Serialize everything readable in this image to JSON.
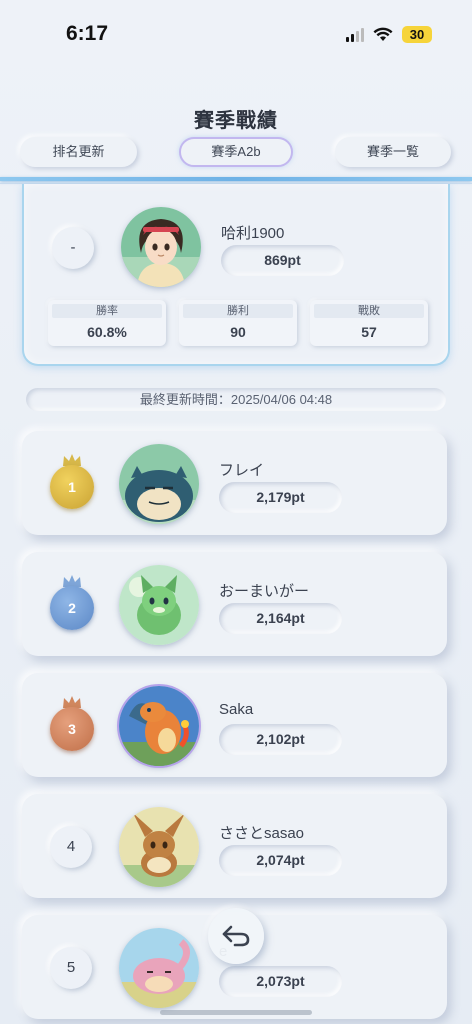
{
  "status_bar": {
    "time": "6:17",
    "battery": "30"
  },
  "header": {
    "title": "賽季戰績",
    "tabs": [
      {
        "label": "排名更新"
      },
      {
        "label": "賽季A2b"
      },
      {
        "label": "賽季一覧"
      }
    ]
  },
  "my_record": {
    "rank": "-",
    "name": "哈利1900",
    "points": "869pt",
    "stats": [
      {
        "label": "勝率",
        "value": "60.8%"
      },
      {
        "label": "勝利",
        "value": "90"
      },
      {
        "label": "戰敗",
        "value": "57"
      }
    ]
  },
  "last_updated": "最終更新時間：2025/04/06 04:48",
  "ranking": [
    {
      "rank": "1",
      "name": "フレイ",
      "points": "2,179pt"
    },
    {
      "rank": "2",
      "name": "おーまいがー",
      "points": "2,164pt"
    },
    {
      "rank": "3",
      "name": "Saka",
      "points": "2,102pt"
    },
    {
      "rank": "4",
      "name": "ささとsasao",
      "points": "2,074pt"
    },
    {
      "rank": "5",
      "name": "e",
      "points": "2,073pt"
    }
  ],
  "colors": {
    "accent_line": "#6fb2e6",
    "gold": "#c9a233",
    "silver": "#5c88c6",
    "bronze": "#c06f48"
  },
  "icons": {
    "back": "return-arrow-icon",
    "crown": "crown-icon"
  }
}
